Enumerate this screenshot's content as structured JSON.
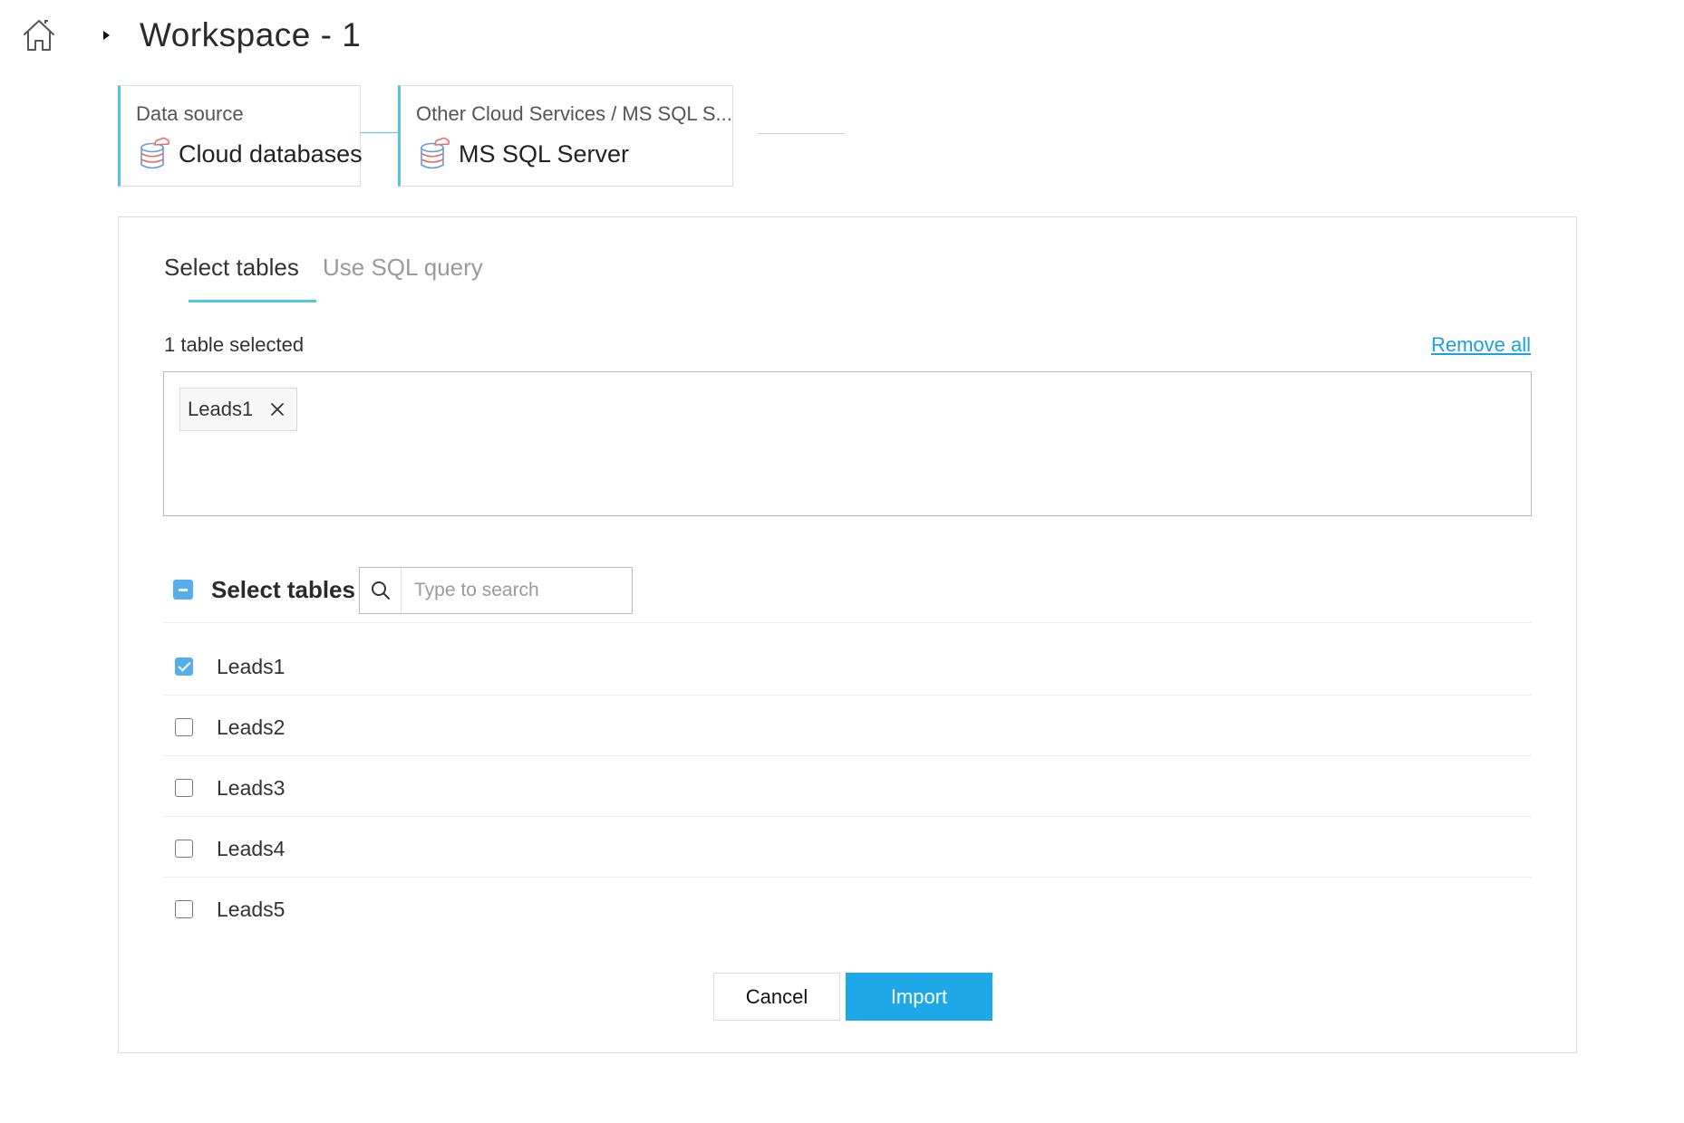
{
  "header": {
    "workspace_title": "Workspace - 1"
  },
  "steps": [
    {
      "label": "Data source",
      "value": "Cloud databases"
    },
    {
      "label": "Other Cloud Services / MS SQL S...",
      "value": "MS SQL Server"
    }
  ],
  "tabs": [
    {
      "label": "Select tables",
      "active": true
    },
    {
      "label": "Use SQL query",
      "active": false
    }
  ],
  "selection": {
    "count_text": "1 table selected",
    "remove_all_label": "Remove all",
    "chips": [
      "Leads1"
    ]
  },
  "table_list": {
    "title": "Select tables",
    "search_placeholder": "Type to search",
    "items": [
      {
        "label": "Leads1",
        "checked": true
      },
      {
        "label": "Leads2",
        "checked": false
      },
      {
        "label": "Leads3",
        "checked": false
      },
      {
        "label": "Leads4",
        "checked": false
      },
      {
        "label": "Leads5",
        "checked": false
      }
    ]
  },
  "buttons": {
    "cancel_label": "Cancel",
    "import_label": "Import"
  },
  "colors": {
    "accent": "#56c1ec",
    "primary_button": "#1fa8e8",
    "link": "#1a9fe0",
    "checkbox": "#56aeea"
  }
}
